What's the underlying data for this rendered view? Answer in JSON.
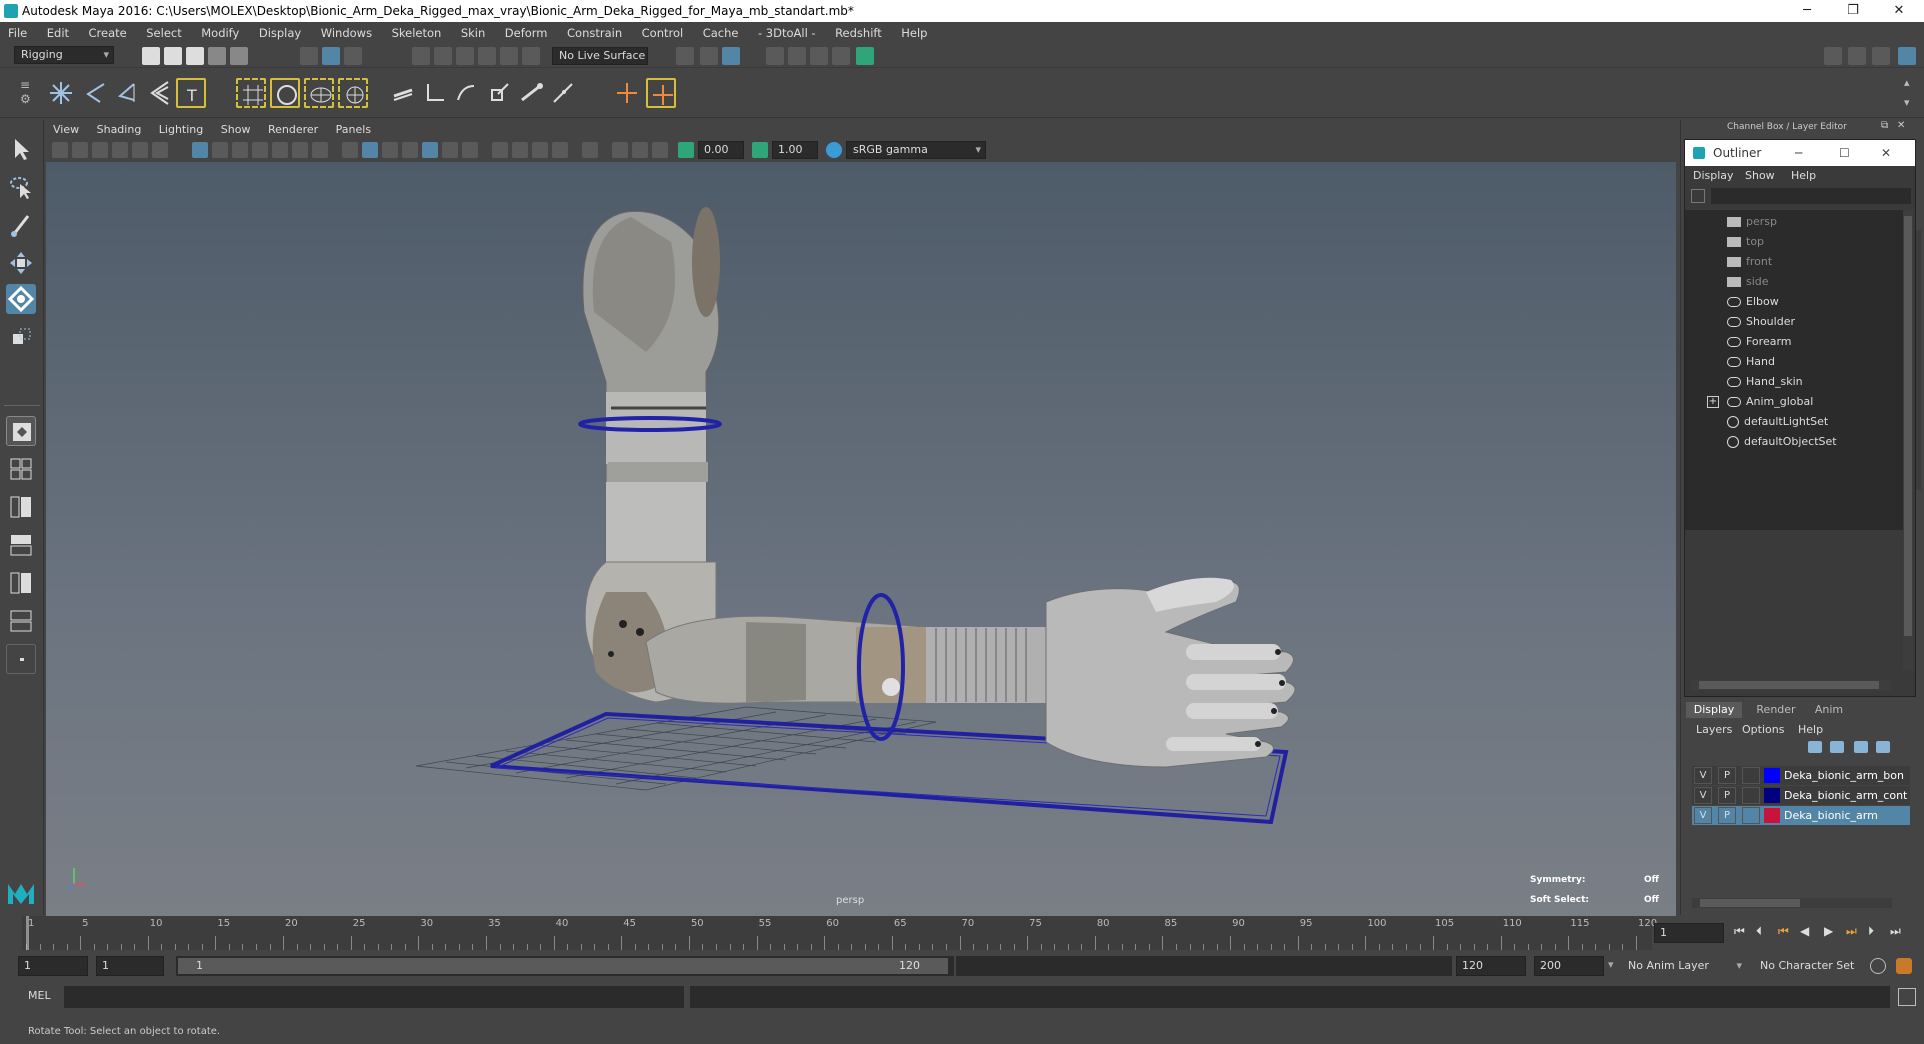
{
  "window": {
    "title": "Autodesk Maya 2016: C:\\Users\\MOLEX\\Desktop\\Bionic_Arm_Deka_Rigged_max_vray\\Bionic_Arm_Deka_Rigged_for_Maya_mb_standart.mb*",
    "minimize": "─",
    "restore": "❐",
    "close": "✕"
  },
  "menus": [
    "File",
    "Edit",
    "Create",
    "Select",
    "Modify",
    "Display",
    "Windows",
    "Skeleton",
    "Skin",
    "Deform",
    "Constrain",
    "Control",
    "Cache",
    "- 3DtoAll -",
    "Redshift",
    "Help"
  ],
  "status": {
    "menuset": "Rigging",
    "live_surface": "No Live Surface"
  },
  "viewport_menu": [
    "View",
    "Shading",
    "Lighting",
    "Show",
    "Renderer",
    "Panels"
  ],
  "viewport_toolbar": {
    "exposure": "0.00",
    "gamma": "1.00",
    "colorspace": "sRGB gamma"
  },
  "viewport": {
    "camera": "persp",
    "symmetry_label": "Symmetry:",
    "symmetry_value": "Off",
    "soft_select_label": "Soft Select:",
    "soft_select_value": "Off"
  },
  "channelbox": {
    "title": "Channel Box / Layer Editor"
  },
  "outliner": {
    "title": "Outliner",
    "menu": [
      "Display",
      "Show",
      "Help"
    ],
    "items": [
      {
        "label": "persp",
        "type": "camera",
        "dim": true
      },
      {
        "label": "top",
        "type": "camera",
        "dim": true
      },
      {
        "label": "front",
        "type": "camera",
        "dim": true
      },
      {
        "label": "side",
        "type": "camera",
        "dim": true
      },
      {
        "label": "Elbow",
        "type": "transform",
        "dim": false
      },
      {
        "label": "Shoulder",
        "type": "transform",
        "dim": false
      },
      {
        "label": "Forearm",
        "type": "transform",
        "dim": false
      },
      {
        "label": "Hand",
        "type": "transform",
        "dim": false
      },
      {
        "label": "Hand_skin",
        "type": "transform",
        "dim": false
      },
      {
        "label": "Anim_global",
        "type": "transform",
        "dim": false,
        "expandable": true
      },
      {
        "label": "defaultLightSet",
        "type": "set",
        "dim": false
      },
      {
        "label": "defaultObjectSet",
        "type": "set",
        "dim": false
      }
    ]
  },
  "layer_editor": {
    "tabs": [
      "Display",
      "Render",
      "Anim"
    ],
    "menu": [
      "Layers",
      "Options",
      "Help"
    ],
    "layers": [
      {
        "v": "V",
        "p": "P",
        "color": "#0000ff",
        "name": "Deka_bionic_arm_bon",
        "selected": false
      },
      {
        "v": "V",
        "p": "P",
        "color": "#000080",
        "name": "Deka_bionic_arm_cont",
        "selected": false
      },
      {
        "v": "V",
        "p": "P",
        "color": "#c8143c",
        "name": "Deka_bionic_arm",
        "selected": true
      }
    ]
  },
  "timeline": {
    "ticks": [
      1,
      5,
      10,
      15,
      20,
      25,
      30,
      35,
      40,
      45,
      50,
      55,
      60,
      65,
      70,
      75,
      80,
      85,
      90,
      95,
      100,
      105,
      110,
      115,
      120
    ],
    "current_frame": "1"
  },
  "range": {
    "start": "1",
    "anim_start": "1",
    "slider_start": "1",
    "slider_end": "120",
    "anim_end": "120",
    "end": "200",
    "anim_layer": "No Anim Layer",
    "character_set": "No Character Set"
  },
  "command": {
    "label": "MEL"
  },
  "help": {
    "text": "Rotate Tool: Select an object to rotate."
  }
}
